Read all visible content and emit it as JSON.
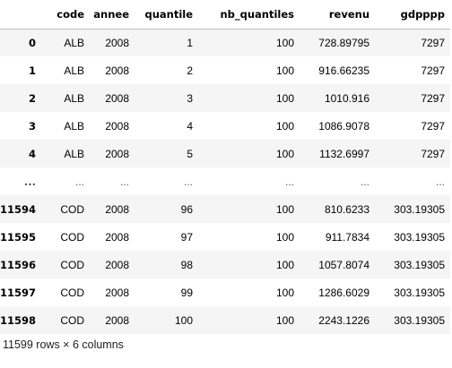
{
  "table": {
    "columns": [
      "code",
      "annee",
      "quantile",
      "nb_quantiles",
      "revenu",
      "gdpppp"
    ],
    "rows": [
      {
        "index": "0",
        "cells": [
          "ALB",
          "2008",
          "1",
          "100",
          "728.89795",
          "7297"
        ]
      },
      {
        "index": "1",
        "cells": [
          "ALB",
          "2008",
          "2",
          "100",
          "916.66235",
          "7297"
        ]
      },
      {
        "index": "2",
        "cells": [
          "ALB",
          "2008",
          "3",
          "100",
          "1010.916",
          "7297"
        ]
      },
      {
        "index": "3",
        "cells": [
          "ALB",
          "2008",
          "4",
          "100",
          "1086.9078",
          "7297"
        ]
      },
      {
        "index": "4",
        "cells": [
          "ALB",
          "2008",
          "5",
          "100",
          "1132.6997",
          "7297"
        ]
      },
      {
        "index": "...",
        "cells": [
          "...",
          "...",
          "...",
          "...",
          "...",
          "..."
        ]
      },
      {
        "index": "11594",
        "cells": [
          "COD",
          "2008",
          "96",
          "100",
          "810.6233",
          "303.19305"
        ]
      },
      {
        "index": "11595",
        "cells": [
          "COD",
          "2008",
          "97",
          "100",
          "911.7834",
          "303.19305"
        ]
      },
      {
        "index": "11596",
        "cells": [
          "COD",
          "2008",
          "98",
          "100",
          "1057.8074",
          "303.19305"
        ]
      },
      {
        "index": "11597",
        "cells": [
          "COD",
          "2008",
          "99",
          "100",
          "1286.6029",
          "303.19305"
        ]
      },
      {
        "index": "11598",
        "cells": [
          "COD",
          "2008",
          "100",
          "100",
          "2243.1226",
          "303.19305"
        ]
      }
    ]
  },
  "footer": "11599 rows × 6 columns"
}
